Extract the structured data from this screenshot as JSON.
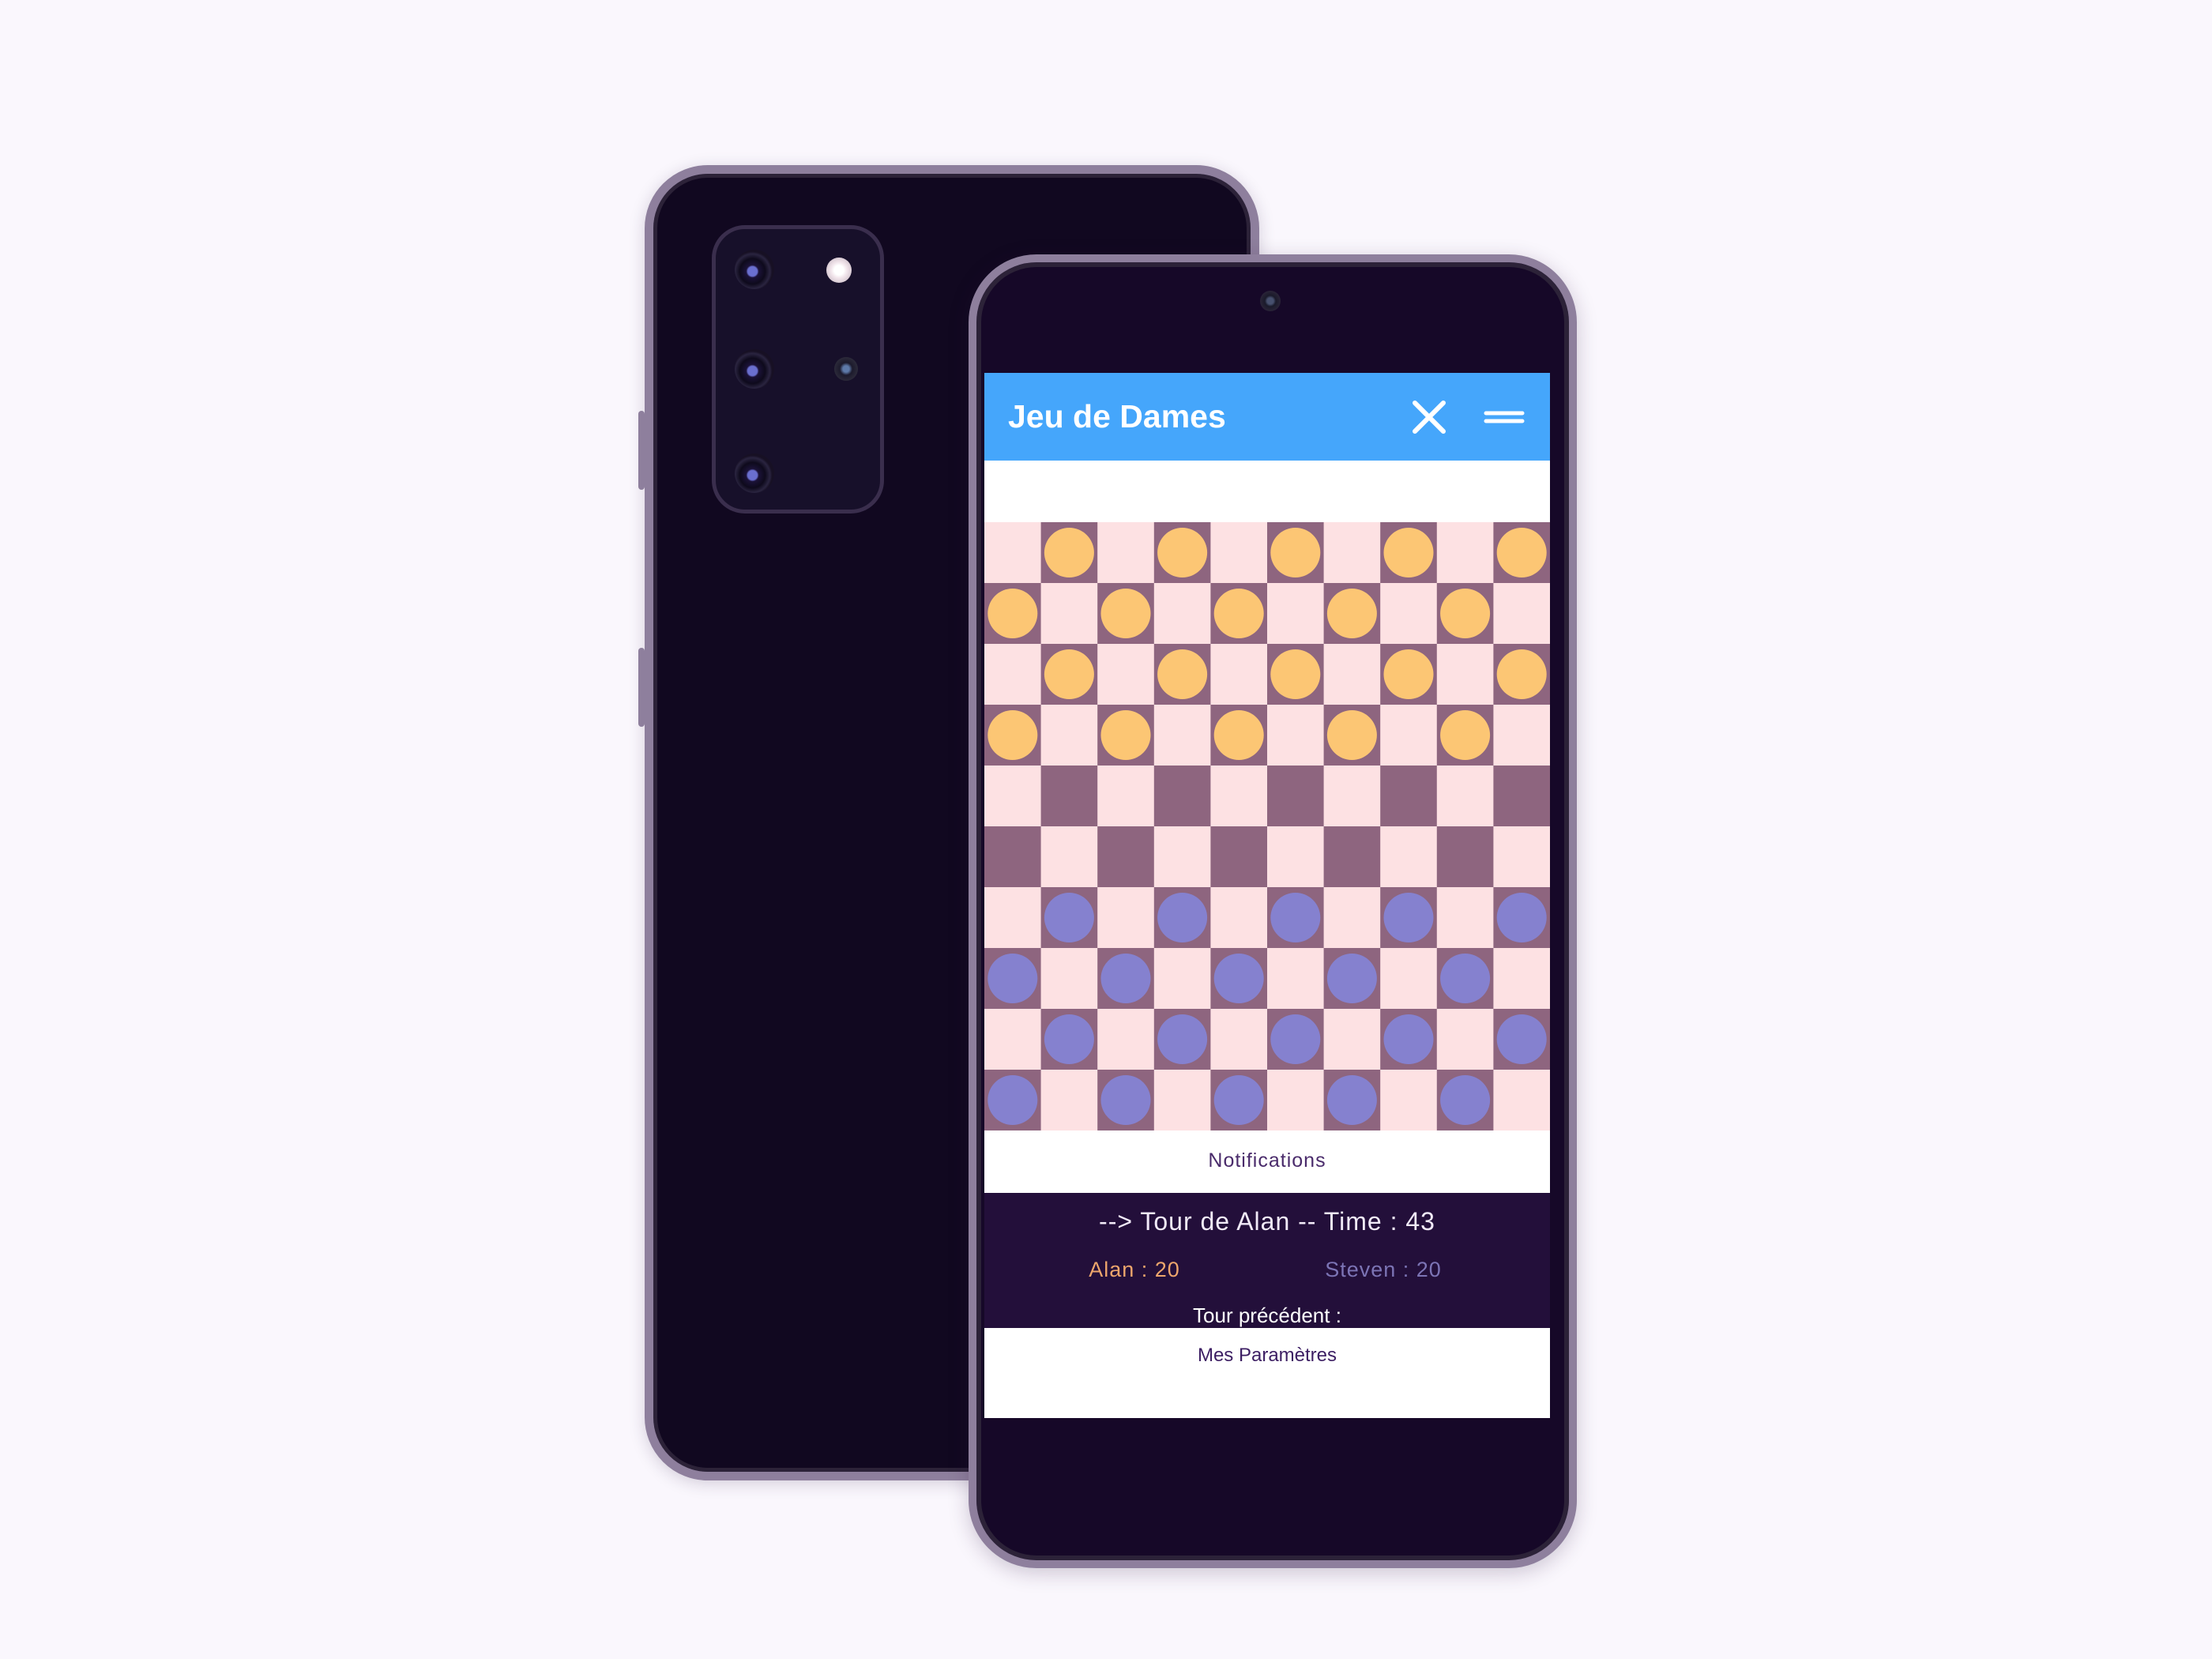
{
  "app": {
    "title": "Jeu de Dames"
  },
  "icons": {
    "close": "close-icon",
    "menu": "menu-icon"
  },
  "board": {
    "size": 10,
    "colors": {
      "light_square": "#fde1e3",
      "dark_square": "#8e657f",
      "player1_piece": "#fcc674",
      "player2_piece": "#8581cf"
    },
    "pieces": [
      {
        "row": 0,
        "col": 1,
        "player": 1
      },
      {
        "row": 0,
        "col": 3,
        "player": 1
      },
      {
        "row": 0,
        "col": 5,
        "player": 1
      },
      {
        "row": 0,
        "col": 7,
        "player": 1
      },
      {
        "row": 0,
        "col": 9,
        "player": 1
      },
      {
        "row": 1,
        "col": 0,
        "player": 1
      },
      {
        "row": 1,
        "col": 2,
        "player": 1
      },
      {
        "row": 1,
        "col": 4,
        "player": 1
      },
      {
        "row": 1,
        "col": 6,
        "player": 1
      },
      {
        "row": 1,
        "col": 8,
        "player": 1
      },
      {
        "row": 2,
        "col": 1,
        "player": 1
      },
      {
        "row": 2,
        "col": 3,
        "player": 1
      },
      {
        "row": 2,
        "col": 5,
        "player": 1
      },
      {
        "row": 2,
        "col": 7,
        "player": 1
      },
      {
        "row": 2,
        "col": 9,
        "player": 1
      },
      {
        "row": 3,
        "col": 0,
        "player": 1
      },
      {
        "row": 3,
        "col": 2,
        "player": 1
      },
      {
        "row": 3,
        "col": 4,
        "player": 1
      },
      {
        "row": 3,
        "col": 6,
        "player": 1
      },
      {
        "row": 3,
        "col": 8,
        "player": 1
      },
      {
        "row": 6,
        "col": 1,
        "player": 2
      },
      {
        "row": 6,
        "col": 3,
        "player": 2
      },
      {
        "row": 6,
        "col": 5,
        "player": 2
      },
      {
        "row": 6,
        "col": 7,
        "player": 2
      },
      {
        "row": 6,
        "col": 9,
        "player": 2
      },
      {
        "row": 7,
        "col": 0,
        "player": 2
      },
      {
        "row": 7,
        "col": 2,
        "player": 2
      },
      {
        "row": 7,
        "col": 4,
        "player": 2
      },
      {
        "row": 7,
        "col": 6,
        "player": 2
      },
      {
        "row": 7,
        "col": 8,
        "player": 2
      },
      {
        "row": 8,
        "col": 1,
        "player": 2
      },
      {
        "row": 8,
        "col": 3,
        "player": 2
      },
      {
        "row": 8,
        "col": 5,
        "player": 2
      },
      {
        "row": 8,
        "col": 7,
        "player": 2
      },
      {
        "row": 8,
        "col": 9,
        "player": 2
      },
      {
        "row": 9,
        "col": 0,
        "player": 2
      },
      {
        "row": 9,
        "col": 2,
        "player": 2
      },
      {
        "row": 9,
        "col": 4,
        "player": 2
      },
      {
        "row": 9,
        "col": 6,
        "player": 2
      },
      {
        "row": 9,
        "col": 8,
        "player": 2
      }
    ]
  },
  "notifications": {
    "label": "Notifications"
  },
  "status": {
    "turn_text": "--> Tour de Alan -- Time : 43",
    "player1_score": "Alan : 20",
    "player2_score": "Steven : 20",
    "previous_turn_label": "Tour précédent :"
  },
  "footer": {
    "settings_label": "Mes Paramètres"
  }
}
